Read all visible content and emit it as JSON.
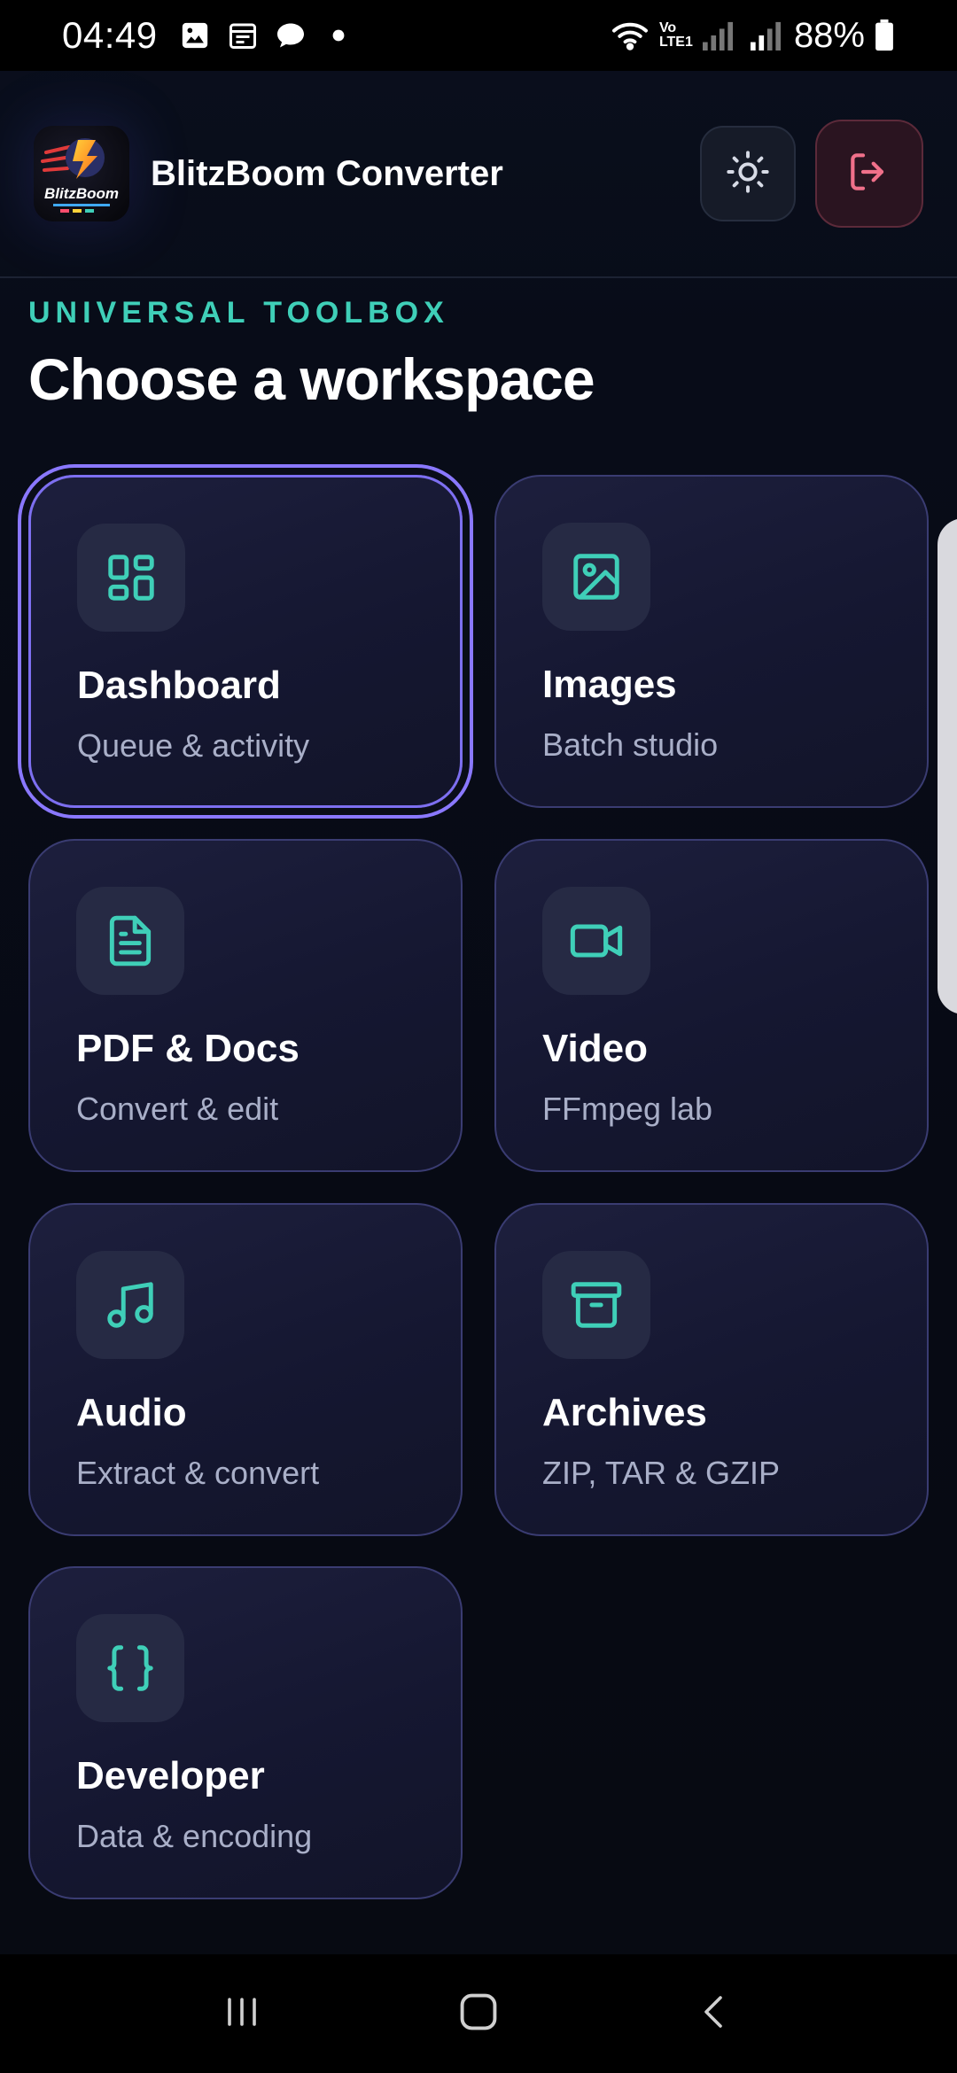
{
  "status_bar": {
    "time": "04:49",
    "network_label": "Vo LTE1",
    "battery": "88%",
    "icons": [
      "gallery-icon",
      "calendar-icon",
      "chat-icon",
      "dot-icon",
      "wifi-icon",
      "signal-icon",
      "battery-icon"
    ]
  },
  "header": {
    "logo_text": "BlitzBoom",
    "title": "BlitzBoom Converter",
    "theme_toggle_icon": "sun-icon",
    "logout_icon": "logout-icon"
  },
  "section": {
    "eyebrow": "UNIVERSAL TOOLBOX",
    "title": "Choose a workspace"
  },
  "workspaces": [
    {
      "title": "Dashboard",
      "subtitle": "Queue & activity",
      "icon": "grid-icon",
      "selected": true
    },
    {
      "title": "Images",
      "subtitle": "Batch studio",
      "icon": "image-icon",
      "selected": false
    },
    {
      "title": "PDF & Docs",
      "subtitle": "Convert & edit",
      "icon": "document-icon",
      "selected": false
    },
    {
      "title": "Video",
      "subtitle": "FFmpeg lab",
      "icon": "video-camera-icon",
      "selected": false
    },
    {
      "title": "Audio",
      "subtitle": "Extract & convert",
      "icon": "music-note-icon",
      "selected": false
    },
    {
      "title": "Archives",
      "subtitle": "ZIP, TAR & GZIP",
      "icon": "archive-box-icon",
      "selected": false
    },
    {
      "title": "Developer",
      "subtitle": "Data & encoding",
      "icon": "braces-icon",
      "selected": false
    }
  ],
  "colors": {
    "accent_teal": "#3fcfb8",
    "accent_purple": "#8a78ff",
    "logout_pink": "#f0708a"
  },
  "nav_bar": {
    "icons": [
      "recent-apps-icon",
      "home-icon",
      "back-icon"
    ]
  }
}
